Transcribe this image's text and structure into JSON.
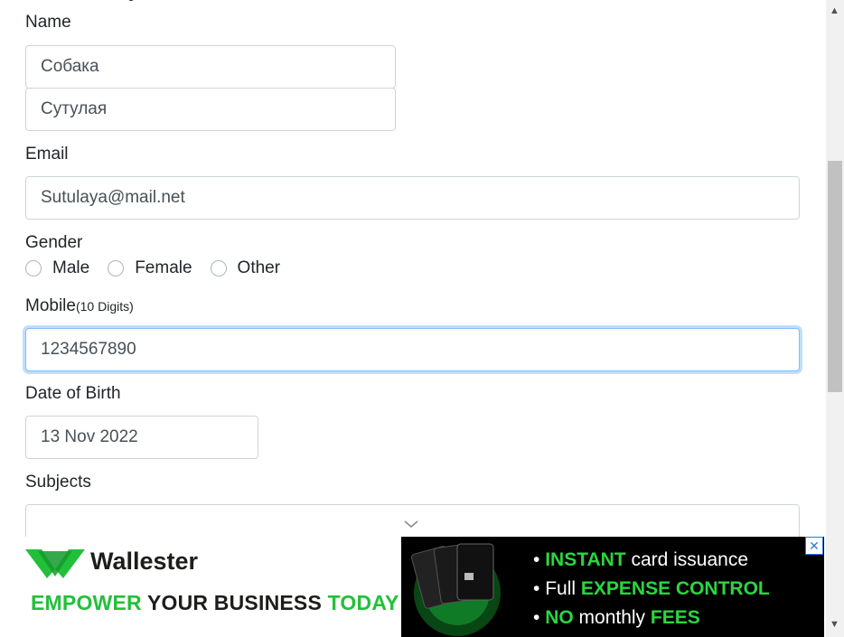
{
  "form": {
    "name_label": "Name",
    "first_name": "Собака",
    "last_name": "Сутулая",
    "email_label": "Email",
    "email": "Sutulaya@mail.net",
    "gender_label": "Gender",
    "gender_options": [
      "Male",
      "Female",
      "Other"
    ],
    "mobile_label": "Mobile",
    "mobile_hint": "(10 Digits)",
    "mobile": "1234567890",
    "dob_label": "Date of Birth",
    "dob": "13 Nov 2022",
    "subjects_label": "Subjects",
    "subjects": ""
  },
  "ad": {
    "brand": "Wallester",
    "tagline_1": "EMPOWER",
    "tagline_2": " YOUR BUSINESS ",
    "tagline_3": "TODAY",
    "b1_dot": "• ",
    "b1_hl": "INSTANT",
    "b1_rest": " card issuance",
    "b2_dot": "• ",
    "b2_pre": "Full ",
    "b2_hl": "EXPENSE CONTROL",
    "b3_dot": "• ",
    "b3_hl": "NO",
    "b3_mid": " monthly ",
    "b3_hl2": "FEES",
    "close": "✕",
    "brand_color": "#22c03a"
  },
  "icons": {
    "scroll_up": "scroll-up-arrow",
    "scroll_down": "scroll-down-arrow",
    "chevron": "chevron-down-icon"
  }
}
